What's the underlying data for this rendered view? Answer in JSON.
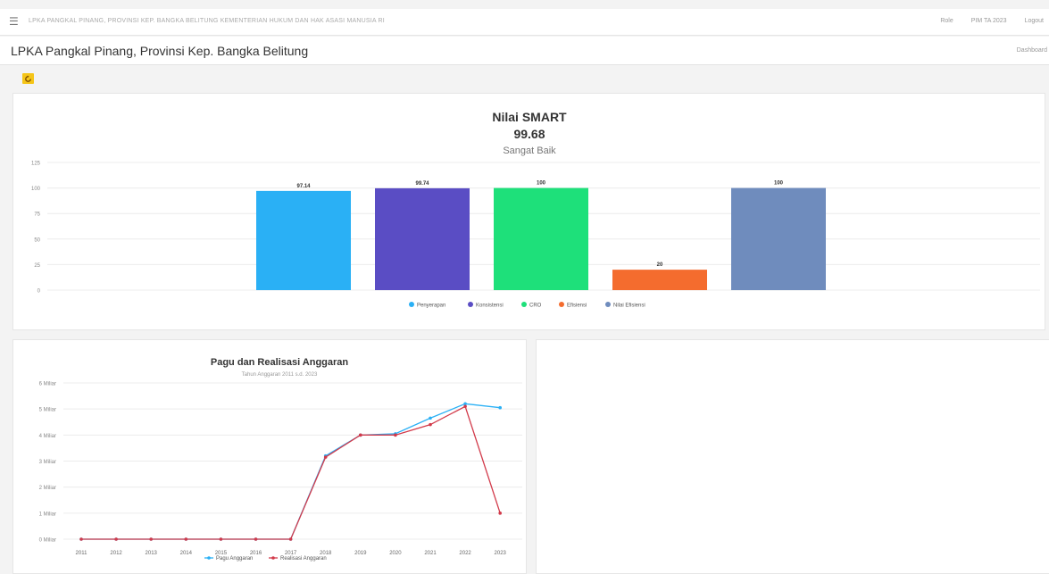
{
  "topbar": {
    "breadcrumb": "LPKA PANGKAL PINANG, PROVINSI KEP. BANGKA BELITUNG KEMENTERIAN HUKUM DAN HAK ASASI MANUSIA RI",
    "links": [
      "Role",
      "PIM TA 2023",
      "Logout"
    ]
  },
  "header": {
    "title": "LPKA Pangkal Pinang, Provinsi Kep. Bangka Belitung",
    "dashboard": "Dashboard"
  },
  "smart": {
    "title": "Nilai SMART",
    "score": "99.68",
    "status": "Sangat Baik"
  },
  "chart_data": [
    {
      "type": "bar",
      "categories": [
        "Penyerapan",
        "Konsistensi",
        "CRO",
        "Efisiensi",
        "Nilai Efisiensi"
      ],
      "values": [
        97.14,
        99.74,
        100,
        20,
        100
      ],
      "labels": [
        "97.14",
        "99.74",
        "100",
        "20",
        "100"
      ],
      "colors": [
        "#2ab0f5",
        "#5a4dc4",
        "#1ee07a",
        "#f46c2e",
        "#6f8cbd"
      ],
      "ylim": [
        0,
        125
      ],
      "yticks": [
        0,
        25,
        50,
        75,
        100,
        125
      ],
      "legend": "bottom",
      "grid": true
    },
    {
      "type": "line",
      "title": "Pagu dan Realisasi Anggaran",
      "subtitle": "Tahun Anggaran 2011 s.d. 2023",
      "x": [
        "2011",
        "2012",
        "2013",
        "2014",
        "2015",
        "2016",
        "2017",
        "2018",
        "2019",
        "2020",
        "2021",
        "2022",
        "2023"
      ],
      "series": [
        {
          "name": "Pagu Anggaran",
          "color": "#2ab0f5",
          "values": [
            0,
            0,
            0,
            0,
            0,
            0,
            0,
            3.2,
            4.0,
            4.05,
            4.65,
            5.2,
            5.05
          ]
        },
        {
          "name": "Realisasi Anggaran",
          "color": "#d23a4a",
          "values": [
            0,
            0,
            0,
            0,
            0,
            0,
            0,
            3.15,
            4.0,
            4.0,
            4.4,
            5.1,
            1.0
          ]
        }
      ],
      "ylim": [
        0,
        6
      ],
      "yticks": [
        "0 Miliar",
        "1 Miliar",
        "2 Miliar",
        "3 Miliar",
        "4 Miliar",
        "5 Miliar",
        "6 Miliar"
      ],
      "legend": "bottom",
      "grid": true
    }
  ]
}
